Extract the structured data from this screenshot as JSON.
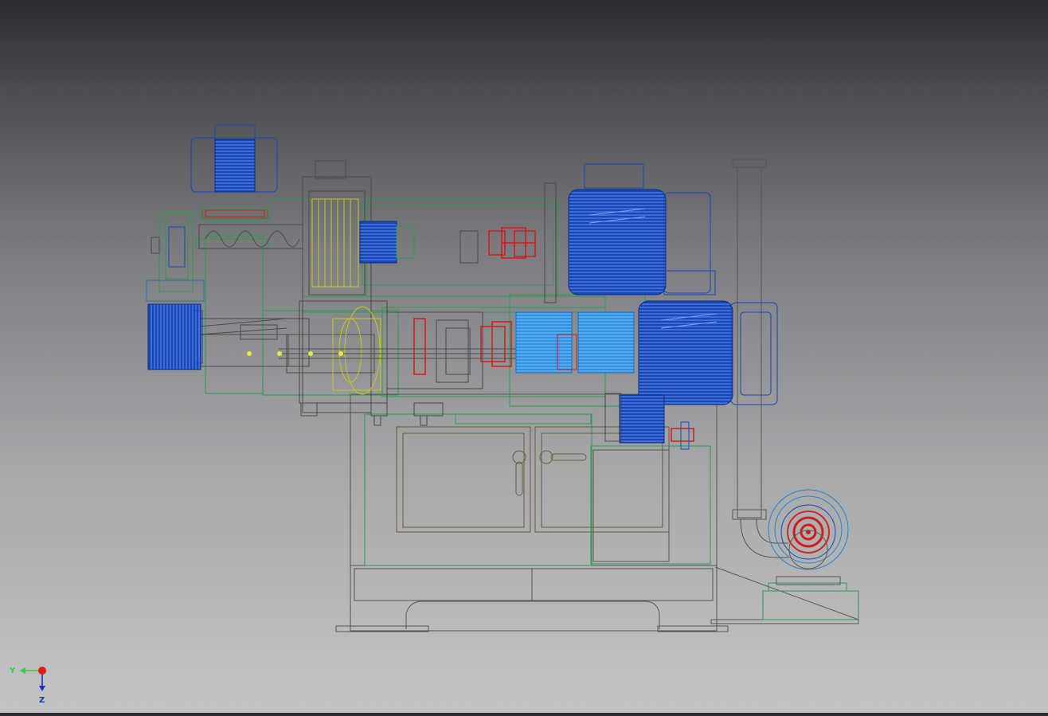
{
  "viewport": {
    "background_top": "#2b2c2f",
    "background_bottom": "#c3c4c6"
  },
  "colors": {
    "motor_blue": "#1646b8",
    "motor_blue_light": "#2f7fd6",
    "wire_green": "#2e9a4e",
    "wire_dark": "#4a4a4a",
    "wire_red": "#d41a1a",
    "wire_yellow": "#c8c81e",
    "wire_brown": "#6e5a3a",
    "wire_cyan": "#2aa0c8"
  },
  "triad": {
    "y_label": "Y",
    "z_label": "Z",
    "icons": [
      "y-axis-arrow-icon",
      "z-axis-arrow-icon",
      "x-axis-origin-icon"
    ]
  }
}
